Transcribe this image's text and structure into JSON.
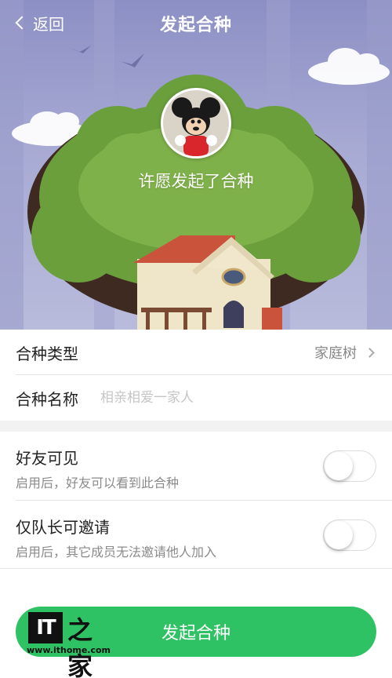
{
  "nav": {
    "back_label": "返回",
    "title": "发起合种"
  },
  "hero": {
    "caption": "许愿发起了合种"
  },
  "form": {
    "type_label": "合种类型",
    "type_value": "家庭树",
    "name_label": "合种名称",
    "name_placeholder": "相亲相爱一家人",
    "name_value": ""
  },
  "toggles": [
    {
      "title": "好友可见",
      "subtitle": "启用后，好友可以看到此合种",
      "enabled": false
    },
    {
      "title": "仅队长可邀请",
      "subtitle": "启用后，其它成员无法邀请他人加入",
      "enabled": false
    }
  ],
  "submit_label": "发起合种",
  "watermark": {
    "logo": "IT",
    "zhi": "之家",
    "url": "www.ithome.com"
  },
  "colors": {
    "accent": "#2ec264",
    "sky": "#a7aad3",
    "tree": "#6a9f3c"
  }
}
